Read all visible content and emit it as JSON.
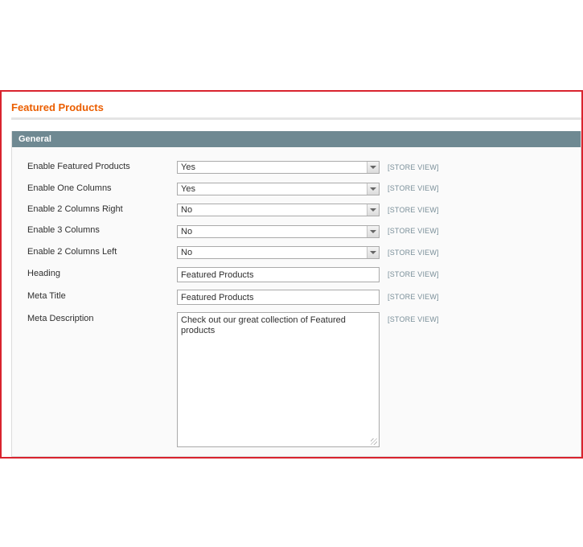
{
  "page": {
    "title": "Featured Products"
  },
  "section": {
    "title": "General"
  },
  "scope_label": "[STORE VIEW]",
  "fields": [
    {
      "label": "Enable Featured Products",
      "type": "select",
      "value": "Yes"
    },
    {
      "label": "Enable One Columns",
      "type": "select",
      "value": "Yes"
    },
    {
      "label": "Enable 2 Columns Right",
      "type": "select",
      "value": "No"
    },
    {
      "label": "Enable 3 Columns",
      "type": "select",
      "value": "No"
    },
    {
      "label": "Enable 2 Columns Left",
      "type": "select",
      "value": "No"
    },
    {
      "label": "Heading",
      "type": "input",
      "value": "Featured Products"
    },
    {
      "label": "Meta Title",
      "type": "input",
      "value": "Featured Products"
    },
    {
      "label": "Meta Description",
      "type": "textarea",
      "value": "Check out our great collection of Featured products"
    }
  ],
  "colors": {
    "frame_border": "#d9232e",
    "title": "#eb5e00",
    "section_header": "#6f8992",
    "scope": "#7a8f99"
  }
}
